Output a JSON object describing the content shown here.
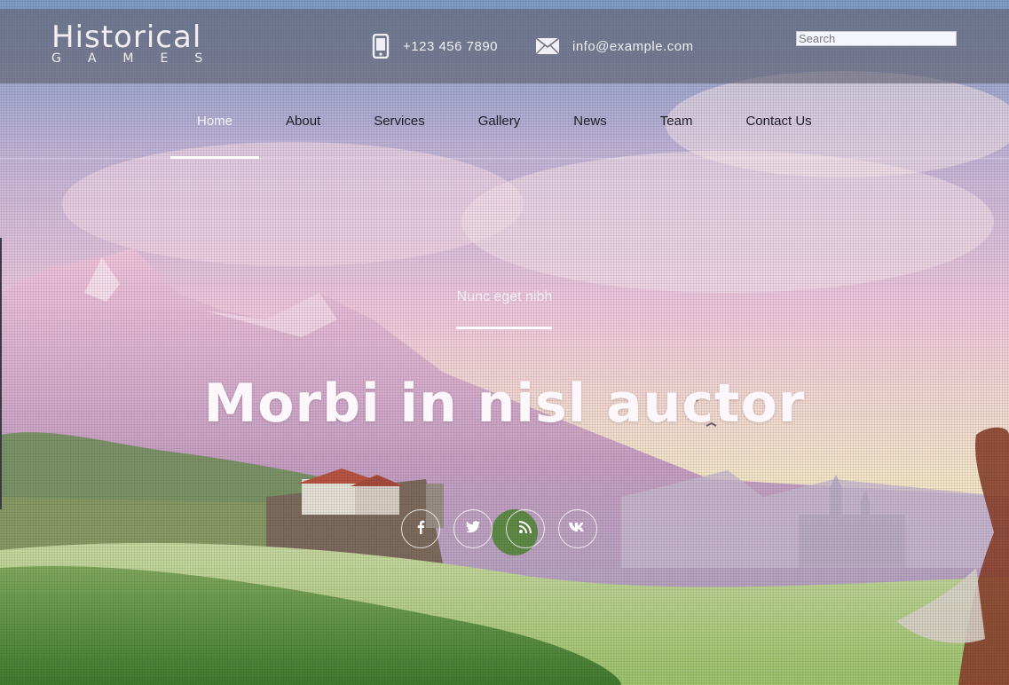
{
  "brand": {
    "title_line1": "Historical",
    "title_line2": "GAMES"
  },
  "contact": {
    "phone": "+123 456 7890",
    "email": "info@example.com",
    "phone_icon": "smartphone-icon",
    "email_icon": "envelope-icon"
  },
  "search": {
    "placeholder": "Search",
    "value": ""
  },
  "nav": {
    "active": "Home",
    "items": [
      {
        "label": "Home"
      },
      {
        "label": "About"
      },
      {
        "label": "Services"
      },
      {
        "label": "Gallery"
      },
      {
        "label": "News"
      },
      {
        "label": "Team"
      },
      {
        "label": "Contact Us"
      }
    ]
  },
  "hero": {
    "subtitle": "Nunc eget nibh",
    "title": "Morbi in nisl auctor"
  },
  "social": [
    {
      "icon": "facebook-icon"
    },
    {
      "icon": "twitter-icon"
    },
    {
      "icon": "rss-icon"
    },
    {
      "icon": "vk-icon"
    }
  ],
  "colors": {
    "topbar": "#5f5f6e",
    "nav_text": "#1d1d28",
    "nav_active_text": "#f4f4f8",
    "hero_text": "#fbf7fb"
  }
}
